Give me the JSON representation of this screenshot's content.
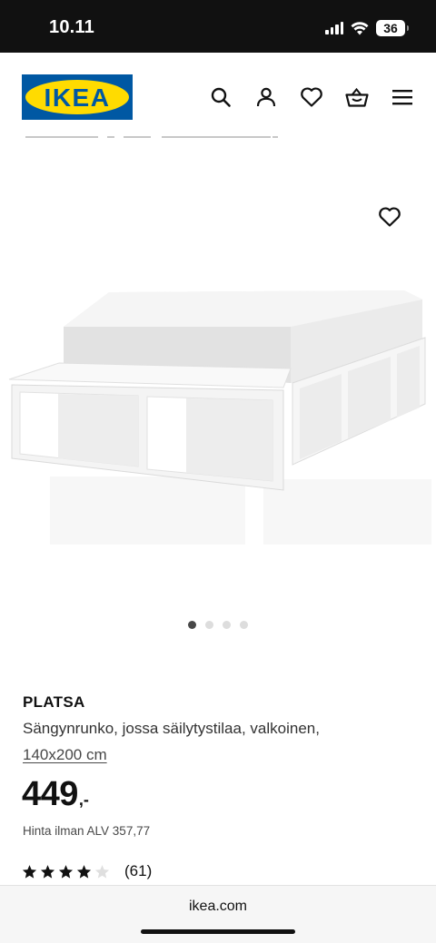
{
  "status_bar": {
    "time": "10.11",
    "battery": "36"
  },
  "header": {
    "logo_text": "IKEA",
    "logo_colors": {
      "blue": "#0058a3",
      "yellow": "#ffdb00"
    },
    "icons": [
      "search-icon",
      "account-icon",
      "wishlist-icon",
      "basket-icon",
      "menu-icon"
    ]
  },
  "gallery": {
    "image": "white platform bed frame with storage compartments and mattress",
    "dots_total": 4,
    "active_dot": 1
  },
  "product": {
    "name": "PLATSA",
    "description": "Sängynrunko, jossa säilytystilaa, valkoinen,",
    "size": "140x200 cm",
    "price_integer": "449",
    "price_suffix": ",-",
    "price_vat": "Hinta ilman ALV 357,77",
    "rating": 4,
    "rating_max": 5,
    "review_count": "(61)"
  },
  "browser": {
    "url": "ikea.com"
  }
}
